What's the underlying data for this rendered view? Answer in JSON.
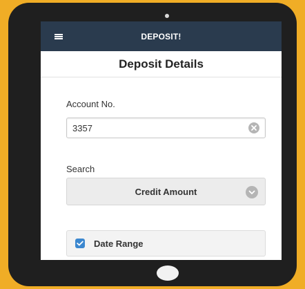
{
  "app": {
    "title": "DEPOSIT!"
  },
  "page": {
    "title": "Deposit Details"
  },
  "account": {
    "label": "Account No.",
    "value": "3357"
  },
  "search": {
    "label": "Search",
    "selected": "Credit Amount"
  },
  "date_range": {
    "label": "Date Range",
    "checked": true
  },
  "colors": {
    "frame": "#f0ad26",
    "device": "#1f1f1f",
    "app_bar": "#2a3b4e",
    "checkbox": "#3b87cf"
  },
  "icons": [
    "menu-icon",
    "clear-icon",
    "chevron-down-icon",
    "checkbox-checked-icon"
  ]
}
